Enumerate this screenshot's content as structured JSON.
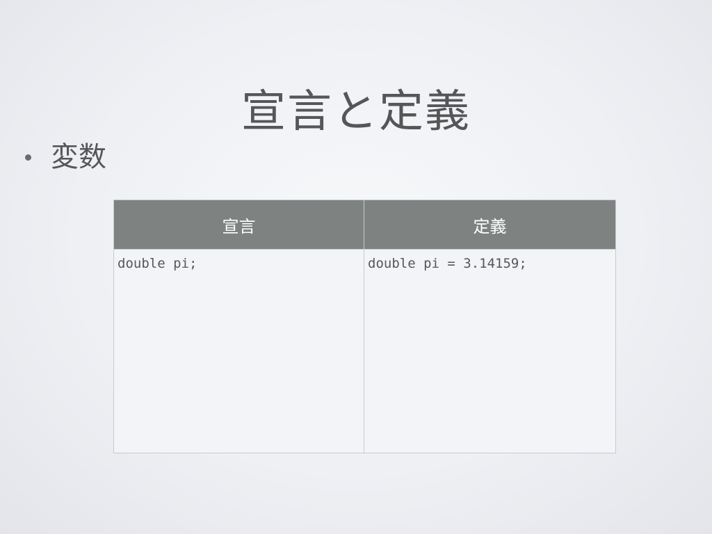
{
  "slide": {
    "title": "宣言と定義",
    "bullets": [
      {
        "text": "変数"
      }
    ]
  },
  "table": {
    "headers": [
      "宣言",
      "定義"
    ],
    "rows": [
      [
        "double pi;",
        "double pi = 3.14159;"
      ]
    ]
  }
}
